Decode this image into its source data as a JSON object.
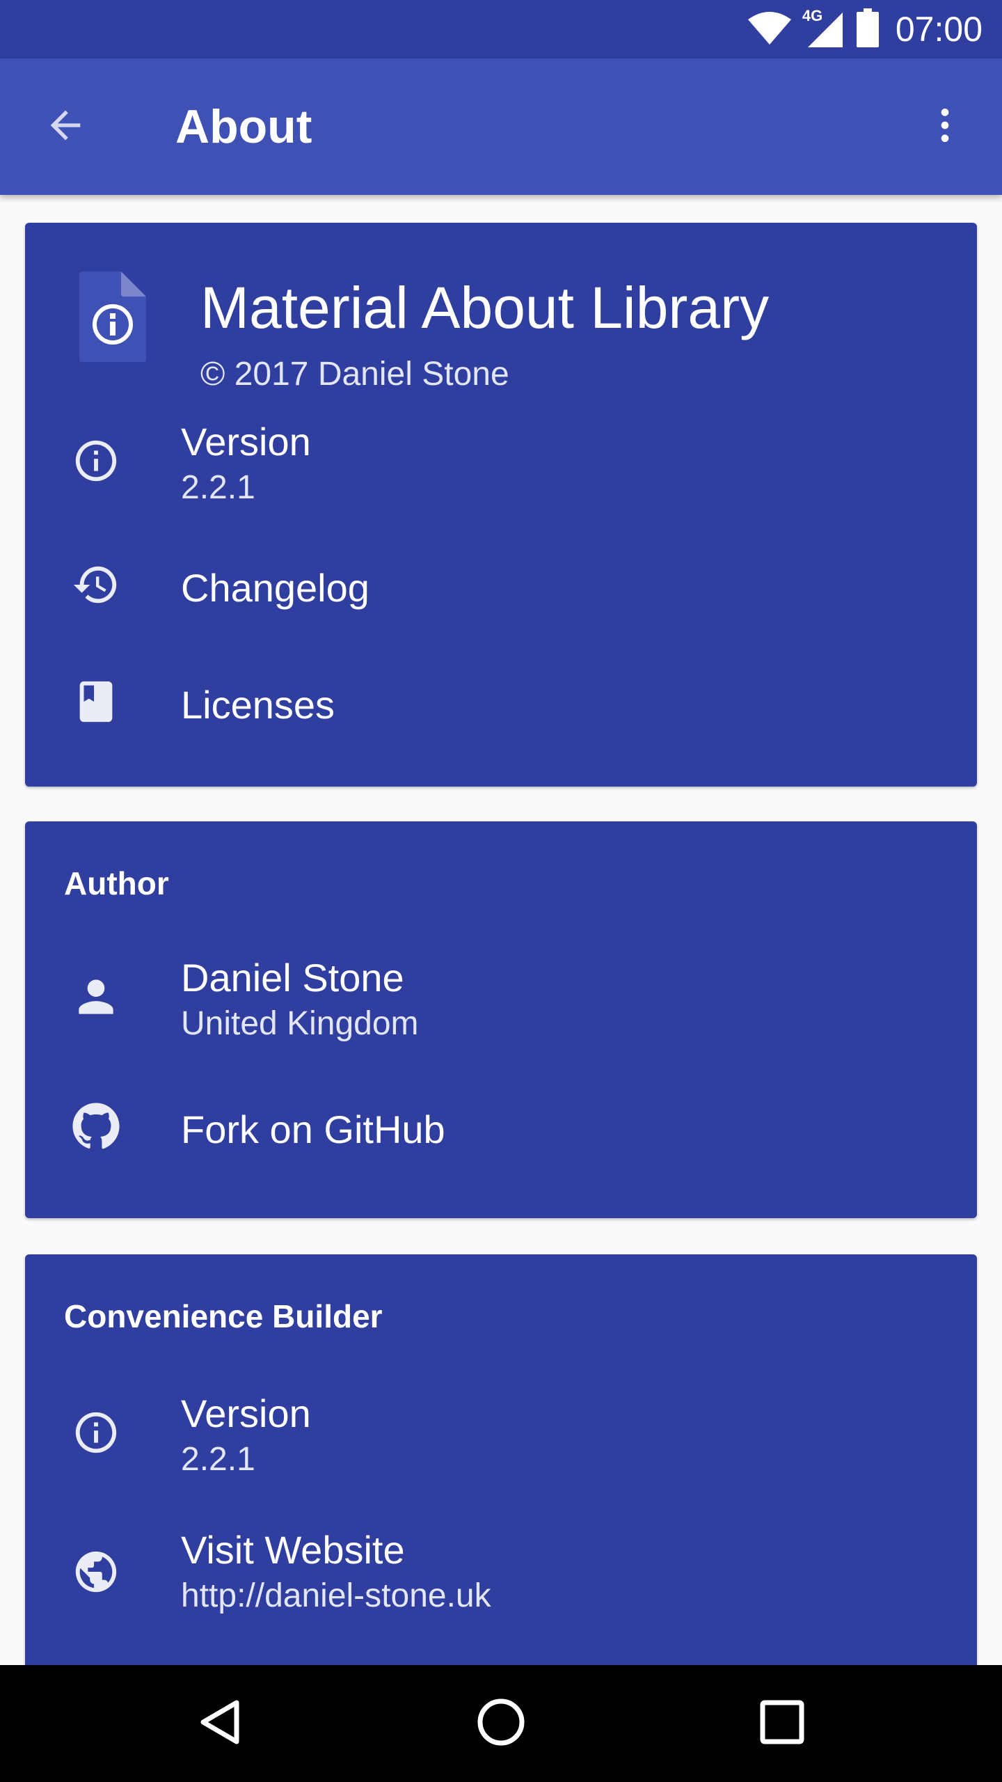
{
  "status_bar": {
    "network_label": "4G",
    "time": "07:00",
    "icons": [
      "wifi-icon",
      "cell-signal-icon",
      "battery-icon"
    ]
  },
  "app_bar": {
    "title": "About",
    "icons": [
      "back-arrow-icon",
      "more-vert-icon"
    ]
  },
  "colors": {
    "primary": "#3f51b5",
    "primary_dark": "#303f9f",
    "background": "#fafafa",
    "text_primary": "#ffffff"
  },
  "cards": {
    "app": {
      "name": "Material About Library",
      "copyright": "© 2017 Daniel Stone",
      "items": [
        {
          "icon": "info-icon",
          "title": "Version",
          "subtitle": "2.2.1"
        },
        {
          "icon": "history-icon",
          "title": "Changelog"
        },
        {
          "icon": "book-icon",
          "title": "Licenses"
        }
      ]
    },
    "author": {
      "title": "Author",
      "items": [
        {
          "icon": "person-icon",
          "title": "Daniel Stone",
          "subtitle": "United Kingdom"
        },
        {
          "icon": "github-icon",
          "title": "Fork on GitHub"
        }
      ]
    },
    "builder": {
      "title": "Convenience Builder",
      "items": [
        {
          "icon": "info-icon",
          "title": "Version",
          "subtitle": "2.2.1"
        },
        {
          "icon": "globe-icon",
          "title": "Visit Website",
          "subtitle": "http://daniel-stone.uk"
        }
      ]
    }
  },
  "nav_bar": {
    "icons": [
      "back-triangle-icon",
      "home-circle-icon",
      "recents-square-icon"
    ]
  }
}
